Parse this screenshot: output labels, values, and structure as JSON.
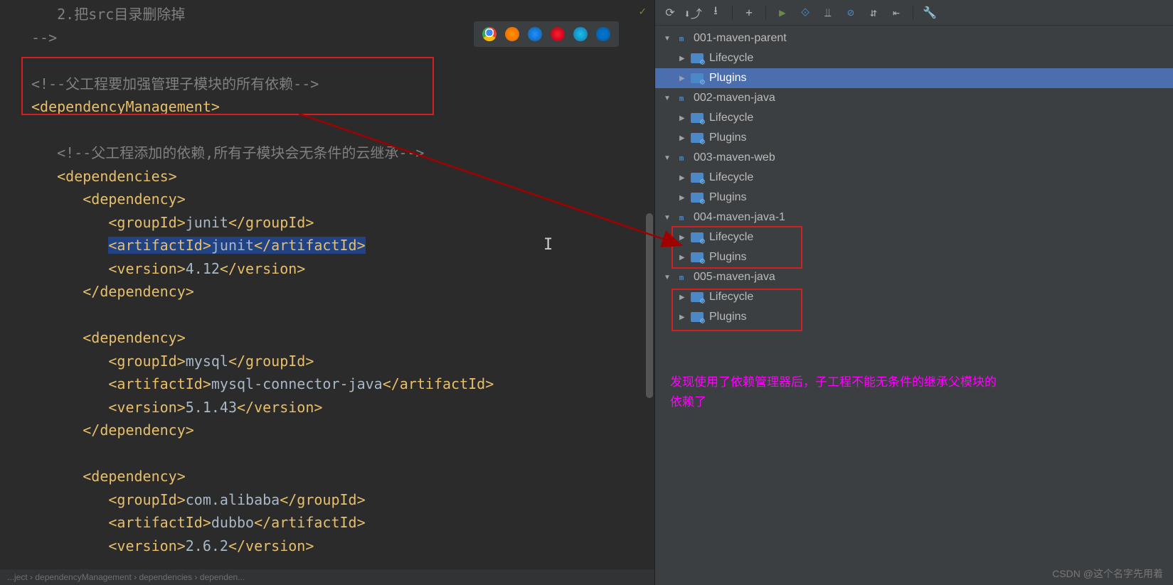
{
  "editor": {
    "line1": "   2.把src目录删除掉",
    "line2": "-->",
    "line3": "",
    "comment1": "<!--父工程要加强管理子模块的所有依赖-->",
    "depMgmt": "<dependencyManagement>",
    "comment2": "   <!--父工程添加的依赖,所有子模块会无条件的云继承-->",
    "deps_open": "   <dependencies>",
    "dep1_open": "      <dependency>",
    "dep1_gid_o": "<groupId>",
    "dep1_gid_v": "junit",
    "dep1_gid_c": "</groupId>",
    "dep1_aid_o": "<artifactId>",
    "dep1_aid_v": "junit",
    "dep1_aid_c": "</artifactId>",
    "dep1_ver_o": "<version>",
    "dep1_ver_v": "4.12",
    "dep1_ver_c": "</version>",
    "dep_close": "      </dependency>",
    "dep2_gid_o": "<groupId>",
    "dep2_gid_v": "mysql",
    "dep2_gid_c": "</groupId>",
    "dep2_aid_o": "<artifactId>",
    "dep2_aid_v": "mysql-connector-java",
    "dep2_aid_c": "</artifactId>",
    "dep2_ver_o": "<version>",
    "dep2_ver_v": "5.1.43",
    "dep2_ver_c": "</version>",
    "dep3_gid_o": "<groupId>",
    "dep3_gid_v": "com.alibaba",
    "dep3_gid_c": "</groupId>",
    "dep3_aid_o": "<artifactId>",
    "dep3_aid_v": "dubbo",
    "dep3_aid_c": "</artifactId>",
    "dep3_ver_o": "<version>",
    "dep3_ver_v": "2.6.2",
    "dep3_ver_c": "</version>",
    "indent9": "         "
  },
  "tree": {
    "n0": "001-maven-parent",
    "n1": "002-maven-java",
    "n2": "003-maven-web",
    "n3": "004-maven-java-1",
    "n4": "005-maven-java",
    "lifecycle": "Lifecycle",
    "plugins": "Plugins"
  },
  "note": {
    "l1": "发现使用了依赖管理器后，子工程不能无条件的继承父模块的",
    "l2": "依赖了"
  },
  "watermark": "CSDN @这个名字先用着",
  "breadcrumb": "...ject  ›  dependencyManagement  ›  dependencies  ›  dependen..."
}
